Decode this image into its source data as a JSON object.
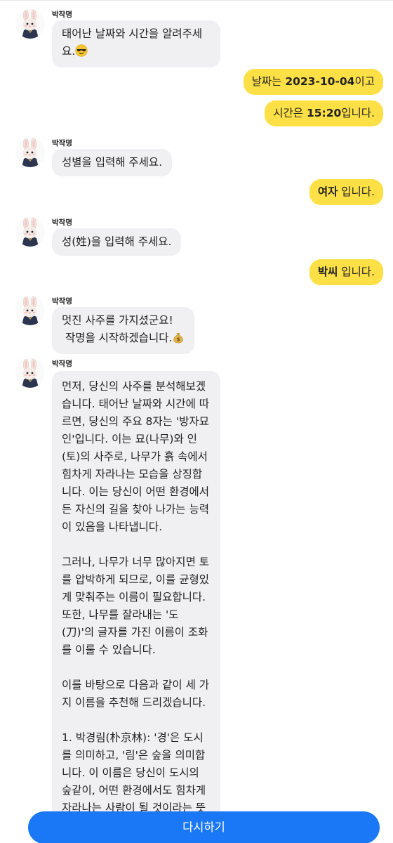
{
  "bot_name": "박작명",
  "icons": {
    "avatar": "rabbit-avatar-icon",
    "sunglasses": "sunglasses-emoji-icon",
    "money_bag": "money-bag-emoji-icon"
  },
  "colors": {
    "user_bubble": "#fce046",
    "bot_bubble": "#f0f0f3",
    "button": "#1a78f6"
  },
  "messages": {
    "m1": {
      "text": "태어난 날짜와 시간을 알려주세\n요."
    },
    "u1": {
      "prefix": "날짜는 ",
      "bold": "2023-10-04",
      "suffix": "이고"
    },
    "u2": {
      "prefix": "시간은 ",
      "bold": "15:20",
      "suffix": "입니다."
    },
    "m2": {
      "text": "성별을 입력해 주세요."
    },
    "u3": {
      "prefix": "",
      "bold": "여자",
      "suffix": " 입니다."
    },
    "m3": {
      "text": "성(姓)을 입력해 주세요."
    },
    "u4": {
      "prefix": "",
      "bold": "박씨",
      "suffix": " 입니다."
    },
    "m4": {
      "line1": "멋진 사주를 가지셨군요!",
      "line2": " 작명을 시작하겠습니다."
    },
    "m5": {
      "text": "먼저, 당신의 사주를 분석해보겠습니다. 태어난 날짜와 시간에 따르면, 당신의 주요 8자는 '방자묘인'입니다. 이는 묘(나무)와 인(토)의 사주로, 나무가 흙 속에서 힘차게 자라나는 모습을 상징합니다. 이는 당신이 어떤 환경에서든 자신의 길을 찾아 나가는 능력이 있음을 나타냅니다.\n\n그러나, 나무가 너무 많아지면 토를 압박하게 되므로, 이를 균형있게 맞춰주는 이름이 필요합니다. 또한, 나무를 잘라내는 '도(刀)'의 글자를 가진 이름이 조화를 이룰 수 있습니다.\n\n이를 바탕으로 다음과 같이 세 가지 이름을 추천해 드리겠습니다.\n\n1. 박경림(朴京林): '경'은 도시를 의미하고, '림'은 숲을 의미합니다. 이 이름은 당신이 도시의 숲같이, 어떤 환경에서도 힘차게 자라나는 사람이 될 것이라는 뜻을 담고 있습니다."
    }
  },
  "retry_label": "다시하기"
}
